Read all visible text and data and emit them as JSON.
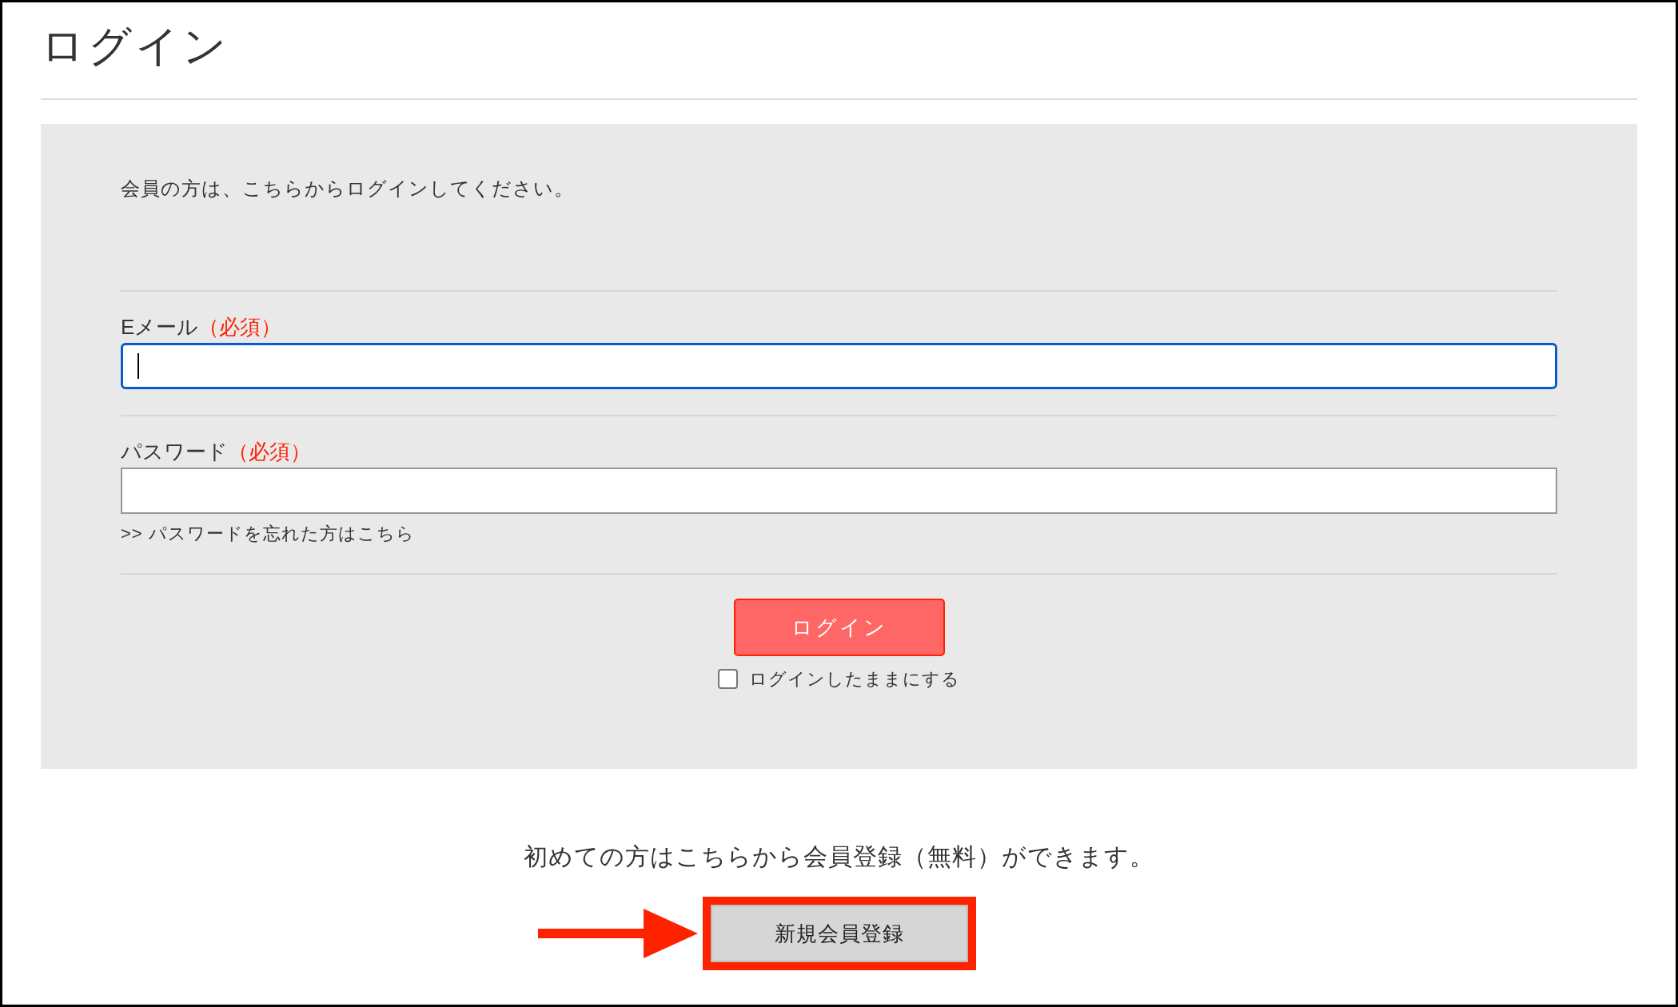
{
  "page": {
    "title": "ログイン"
  },
  "login_panel": {
    "intro": "会員の方は、こちらからログインしてください。",
    "fields": [
      {
        "label": "Eメール",
        "required_mark": "（必須）",
        "focused": true
      },
      {
        "label": "パスワード",
        "required_mark": "（必須）",
        "focused": false,
        "link": ">> パスワードを忘れた方はこちら"
      }
    ],
    "login_button": "ログイン",
    "remember": {
      "label": "ログインしたままにする",
      "checked": false
    }
  },
  "register": {
    "text": "初めての方はこちらから会員登録（無料）ができます。",
    "button": "新規会員登録",
    "highlighted": true
  }
}
